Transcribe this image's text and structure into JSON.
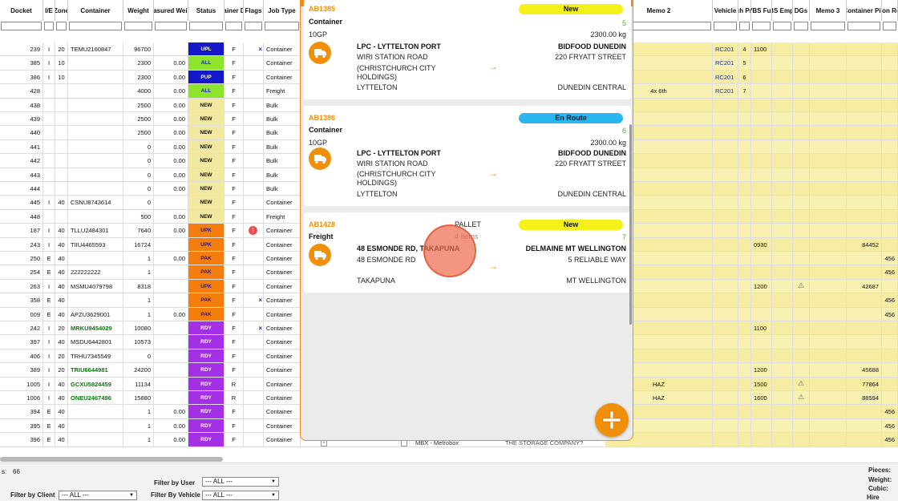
{
  "headers": [
    "Docket",
    "I/E",
    "Zone",
    "Container",
    "Weight",
    "Measured Weight",
    "Status",
    "Container Doors",
    "Flags",
    "Job Type",
    "Memo 2",
    "Vehicle",
    "Sch Pric",
    "VBS Full",
    "VBS Empty",
    "DGs",
    "Memo 3",
    "Container Pin",
    "Con Rel"
  ],
  "rows": [
    {
      "docket": "239",
      "ie": "I",
      "zone": "20",
      "container": "TEMU2160847",
      "weight": "96700",
      "meas": "",
      "status": "UPL",
      "doors": "F",
      "flag": "x",
      "job": "Container",
      "memo2": "",
      "vehicle": "RC201",
      "sch": "4",
      "vbs": "1100",
      "dg": "",
      "pin": "",
      "rel": ""
    },
    {
      "docket": "385",
      "ie": "I",
      "zone": "10",
      "container": "",
      "weight": "2300",
      "meas": "0.00",
      "status": "ALL",
      "doors": "F",
      "flag": "",
      "job": "Container",
      "memo2": "",
      "vehicle": "RC201",
      "sch": "5",
      "vbs": "",
      "dg": "",
      "pin": "",
      "rel": ""
    },
    {
      "docket": "386",
      "ie": "I",
      "zone": "10",
      "container": "",
      "weight": "2300",
      "meas": "0.00",
      "status": "PUP",
      "doors": "F",
      "flag": "",
      "job": "Container",
      "memo2": "",
      "vehicle": "RC201",
      "sch": "6",
      "vbs": "",
      "dg": "",
      "pin": "",
      "rel": ""
    },
    {
      "docket": "428",
      "ie": "",
      "zone": "",
      "container": "",
      "weight": "4000",
      "meas": "0.00",
      "status": "ALL",
      "doors": "F",
      "flag": "",
      "job": "Freight",
      "memo2": "4x 6th",
      "vehicle": "RC201",
      "sch": "7",
      "vbs": "",
      "dg": "",
      "pin": "",
      "rel": ""
    },
    {
      "docket": "438",
      "ie": "",
      "zone": "",
      "container": "",
      "weight": "2500",
      "meas": "0.00",
      "status": "NEW",
      "doors": "F",
      "flag": "",
      "job": "Bulk",
      "memo2": "",
      "vehicle": "",
      "sch": "",
      "vbs": "",
      "dg": "",
      "pin": "",
      "rel": ""
    },
    {
      "docket": "439",
      "ie": "",
      "zone": "",
      "container": "",
      "weight": "2500",
      "meas": "0.00",
      "status": "NEW",
      "doors": "F",
      "flag": "",
      "job": "Bulk",
      "memo2": "",
      "vehicle": "",
      "sch": "",
      "vbs": "",
      "dg": "",
      "pin": "",
      "rel": ""
    },
    {
      "docket": "440",
      "ie": "",
      "zone": "",
      "container": "",
      "weight": "2500",
      "meas": "0.00",
      "status": "NEW",
      "doors": "F",
      "flag": "",
      "job": "Bulk",
      "memo2": "",
      "vehicle": "",
      "sch": "",
      "vbs": "",
      "dg": "",
      "pin": "",
      "rel": ""
    },
    {
      "docket": "441",
      "ie": "",
      "zone": "",
      "container": "",
      "weight": "0",
      "meas": "0.00",
      "status": "NEW",
      "doors": "F",
      "flag": "",
      "job": "Bulk",
      "memo2": "",
      "vehicle": "",
      "sch": "",
      "vbs": "",
      "dg": "",
      "pin": "",
      "rel": ""
    },
    {
      "docket": "442",
      "ie": "",
      "zone": "",
      "container": "",
      "weight": "0",
      "meas": "0.00",
      "status": "NEW",
      "doors": "F",
      "flag": "",
      "job": "Bulk",
      "memo2": "",
      "vehicle": "",
      "sch": "",
      "vbs": "",
      "dg": "",
      "pin": "",
      "rel": ""
    },
    {
      "docket": "443",
      "ie": "",
      "zone": "",
      "container": "",
      "weight": "0",
      "meas": "0.00",
      "status": "NEW",
      "doors": "F",
      "flag": "",
      "job": "Bulk",
      "memo2": "",
      "vehicle": "",
      "sch": "",
      "vbs": "",
      "dg": "",
      "pin": "",
      "rel": ""
    },
    {
      "docket": "444",
      "ie": "",
      "zone": "",
      "container": "",
      "weight": "0",
      "meas": "0.00",
      "status": "NEW",
      "doors": "F",
      "flag": "",
      "job": "Bulk",
      "memo2": "",
      "vehicle": "",
      "sch": "",
      "vbs": "",
      "dg": "",
      "pin": "",
      "rel": ""
    },
    {
      "docket": "445",
      "ie": "I",
      "zone": "40",
      "container": "CSNU8743614",
      "weight": "0",
      "meas": "",
      "status": "NEW",
      "doors": "F",
      "flag": "",
      "job": "Container",
      "memo2": "",
      "vehicle": "",
      "sch": "",
      "vbs": "",
      "dg": "",
      "pin": "",
      "rel": ""
    },
    {
      "docket": "448",
      "ie": "",
      "zone": "",
      "container": "",
      "weight": "500",
      "meas": "0.00",
      "status": "NEW",
      "doors": "F",
      "flag": "",
      "job": "Freight",
      "memo2": "",
      "vehicle": "",
      "sch": "",
      "vbs": "",
      "dg": "",
      "pin": "",
      "rel": ""
    },
    {
      "docket": "187",
      "ie": "I",
      "zone": "40",
      "container": "TLLU2484301",
      "weight": "7640",
      "meas": "0.00",
      "status": "UPK",
      "doors": "F",
      "flag": "!",
      "job": "Container",
      "memo2": "",
      "vehicle": "",
      "sch": "",
      "vbs": "",
      "dg": "",
      "pin": "",
      "rel": ""
    },
    {
      "docket": "243",
      "ie": "I",
      "zone": "40",
      "container": "TIIU4465593",
      "weight": "16724",
      "meas": "",
      "status": "UPK",
      "doors": "F",
      "flag": "",
      "job": "Container",
      "memo2": "",
      "vehicle": "",
      "sch": "",
      "vbs": "0930",
      "dg": "",
      "pin": "84452",
      "rel": ""
    },
    {
      "docket": "250",
      "ie": "E",
      "zone": "40",
      "container": "",
      "weight": "1",
      "meas": "0.00",
      "status": "PAK",
      "doors": "F",
      "flag": "",
      "job": "Container",
      "memo2": "",
      "vehicle": "",
      "sch": "",
      "vbs": "",
      "dg": "",
      "pin": "",
      "rel": "456"
    },
    {
      "docket": "254",
      "ie": "E",
      "zone": "40",
      "container": "222222222",
      "weight": "1",
      "meas": "",
      "status": "PAK",
      "doors": "F",
      "flag": "",
      "job": "Container",
      "memo2": "",
      "vehicle": "",
      "sch": "",
      "vbs": "",
      "dg": "",
      "pin": "",
      "rel": "456"
    },
    {
      "docket": "263",
      "ie": "I",
      "zone": "40",
      "container": "MSMU4079798",
      "weight": "8318",
      "meas": "",
      "status": "UPK",
      "doors": "F",
      "flag": "",
      "job": "Container",
      "memo2": "",
      "vehicle": "",
      "sch": "",
      "vbs": "1200",
      "dg": "y",
      "pin": "42687",
      "rel": ""
    },
    {
      "docket": "358",
      "ie": "E",
      "zone": "40",
      "container": "",
      "weight": "1",
      "meas": "",
      "status": "PAK",
      "doors": "F",
      "flag": "x",
      "job": "Container",
      "memo2": "",
      "vehicle": "",
      "sch": "",
      "vbs": "",
      "dg": "",
      "pin": "",
      "rel": "456"
    },
    {
      "docket": "009",
      "ie": "E",
      "zone": "40",
      "container": "APZU3629001",
      "weight": "1",
      "meas": "0.00",
      "status": "PAK",
      "doors": "F",
      "flag": "",
      "job": "Container",
      "memo2": "",
      "vehicle": "",
      "sch": "",
      "vbs": "",
      "dg": "",
      "pin": "",
      "rel": "456"
    },
    {
      "docket": "242",
      "ie": "I",
      "zone": "20",
      "container": "MRKU9454029",
      "weight": "10080",
      "meas": "",
      "status": "RDY",
      "doors": "F",
      "flag": "x",
      "job": "Container",
      "memo2": "",
      "vehicle": "",
      "sch": "",
      "vbs": "1100",
      "dg": "",
      "pin": "",
      "rel": "",
      "green": true
    },
    {
      "docket": "397",
      "ie": "I",
      "zone": "40",
      "container": "MSDU6442801",
      "weight": "10573",
      "meas": "",
      "status": "RDY",
      "doors": "F",
      "flag": "",
      "job": "Container",
      "memo2": "",
      "vehicle": "",
      "sch": "",
      "vbs": "",
      "dg": "",
      "pin": "",
      "rel": ""
    },
    {
      "docket": "406",
      "ie": "I",
      "zone": "20",
      "container": "TRHU7345549",
      "weight": "0",
      "meas": "",
      "status": "RDY",
      "doors": "F",
      "flag": "",
      "job": "Container",
      "memo2": "",
      "vehicle": "",
      "sch": "",
      "vbs": "",
      "dg": "",
      "pin": "",
      "rel": ""
    },
    {
      "docket": "389",
      "ie": "I",
      "zone": "20",
      "container": "TRIU6644981",
      "weight": "24200",
      "meas": "",
      "status": "RDY",
      "doors": "F",
      "flag": "",
      "job": "Container",
      "memo2": "",
      "vehicle": "",
      "sch": "",
      "vbs": "1200",
      "dg": "",
      "pin": "45688",
      "rel": "",
      "green": true
    },
    {
      "docket": "1005",
      "ie": "I",
      "zone": "40",
      "container": "GCXU5824459",
      "weight": "11134",
      "meas": "",
      "status": "RDY",
      "doors": "R",
      "flag": "",
      "job": "Container",
      "memo2": "HAZ",
      "vehicle": "",
      "sch": "",
      "vbs": "1500",
      "dg": "y",
      "pin": "77864",
      "rel": "",
      "green": true
    },
    {
      "docket": "1006",
      "ie": "I",
      "zone": "40",
      "container": "ONEU2467496",
      "weight": "15880",
      "meas": "",
      "status": "RDY",
      "doors": "R",
      "flag": "",
      "job": "Container",
      "memo2": "HAZ",
      "vehicle": "",
      "sch": "",
      "vbs": "1600",
      "dg": "y",
      "pin": "88594",
      "rel": "",
      "green": true
    },
    {
      "docket": "394",
      "ie": "E",
      "zone": "40",
      "container": "",
      "weight": "1",
      "meas": "0.00",
      "status": "RDY",
      "doors": "F",
      "flag": "",
      "job": "Container",
      "memo2": "",
      "vehicle": "",
      "sch": "",
      "vbs": "",
      "dg": "",
      "pin": "",
      "rel": "456"
    },
    {
      "docket": "395",
      "ie": "E",
      "zone": "40",
      "container": "",
      "weight": "1",
      "meas": "0.00",
      "status": "RDY",
      "doors": "F",
      "flag": "",
      "job": "Container",
      "memo2": "",
      "vehicle": "",
      "sch": "",
      "vbs": "",
      "dg": "",
      "pin": "",
      "rel": "456"
    },
    {
      "docket": "396",
      "ie": "E",
      "zone": "40",
      "container": "",
      "weight": "1",
      "meas": "0.00",
      "status": "RDY",
      "doors": "F",
      "flag": "",
      "job": "Container",
      "memo2": "",
      "vehicle": "",
      "sch": "",
      "vbs": "",
      "dg": "",
      "pin": "",
      "rel": "456"
    }
  ],
  "status_colors": {
    "UPL": "#1418c8",
    "ALL": "#8ee42a",
    "PUP": "#1418c8",
    "NEW": "#f2e8a0",
    "UPK": "#f57d0c",
    "PAK": "#f57d0c",
    "RDY": "#a430e6"
  },
  "status_text_colors": {
    "UPL": "#ffffff",
    "ALL": "#1418c8",
    "PUP": "#ffffff",
    "NEW": "#111111",
    "UPK": "#1418c8",
    "PAK": "#1418c8",
    "RDY": "#ffffff"
  },
  "peek_row": {
    "mbx": "MBX - Metrobox",
    "company": "THE STORAGE COMPANY?"
  },
  "bottom": {
    "count_label": "s:",
    "count_value": "66",
    "filter_user_label": "Filter by User",
    "filter_client_label": "Filter by Client",
    "filter_vehicle_label": "Filter By Vehicle",
    "all_option": "--- ALL ---",
    "pieces_label": "Pieces:",
    "weight_label": "Weight:",
    "cubic_label": "Cubic:",
    "hire_pallet_label": "Hire Pallet"
  },
  "modal": {
    "cards": [
      {
        "id": "AB1385",
        "type": "Container",
        "status": "New",
        "status_color": "#f4f01a",
        "count": "5",
        "subtype": "10GP",
        "weight": "2300.00 kg",
        "from_name": "LPC - LYTTELTON PORT",
        "from_addr": [
          "WIRI STATION ROAD",
          "(CHRISTCHURCH CITY",
          "HOLDINGS)",
          "LYTTELTON"
        ],
        "to_name": "BIDFOOD DUNEDIN",
        "to_addr": "220 FRYATT STREET",
        "to_city": "DUNEDIN CENTRAL",
        "arrow": "→"
      },
      {
        "id": "AB1386",
        "type": "Container",
        "status": "En Route",
        "status_color": "#2bb6ee",
        "count": "6",
        "subtype": "10GP",
        "weight": "2300.00 kg",
        "from_name": "LPC - LYTTELTON PORT",
        "from_addr": [
          "WIRI STATION ROAD",
          "(CHRISTCHURCH CITY",
          "HOLDINGS)",
          "LYTTELTON"
        ],
        "to_name": "BIDFOOD DUNEDIN",
        "to_addr": "220 FRYATT STREET",
        "to_city": "DUNEDIN CENTRAL",
        "arrow": "→"
      },
      {
        "id": "AB1428",
        "type": "Freight",
        "status": "New",
        "status_color": "#f4f01a",
        "count": "7",
        "subtype": "PALLET",
        "items": "4 Items",
        "from_name": "48 ESMONDE RD, TAKAPUNA",
        "from_addr": [
          "48 ESMONDE RD",
          "",
          "",
          "TAKAPUNA"
        ],
        "to_name": "DELMAINE MT WELLINGTON",
        "to_addr": "5 RELIABLE WAY",
        "to_city": "MT WELLINGTON",
        "arrow": "→"
      }
    ],
    "fab_icon": "plus-icon"
  }
}
